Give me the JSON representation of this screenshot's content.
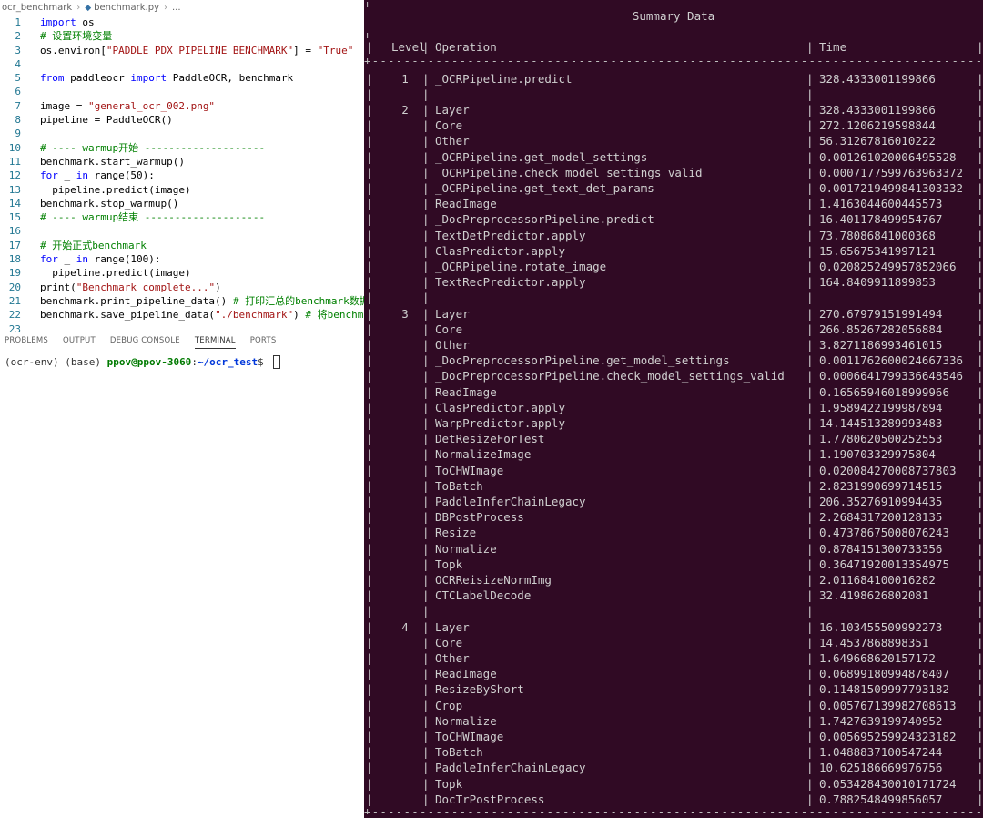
{
  "breadcrumb": {
    "folder": "ocr_benchmark",
    "file": "benchmark.py",
    "ellipsis": "..."
  },
  "code_lines": [
    {
      "n": "1",
      "t": [
        [
          "kw",
          "import"
        ],
        [
          "",
          "  os"
        ]
      ]
    },
    {
      "n": "2",
      "t": [
        [
          "cm",
          "# 设置环境变量"
        ]
      ]
    },
    {
      "n": "3",
      "t": [
        [
          "",
          "os.environ["
        ],
        [
          "str",
          "\"PADDLE_PDX_PIPELINE_BENCHMARK\""
        ],
        [
          "",
          "] = "
        ],
        [
          "str",
          "\"True\""
        ]
      ]
    },
    {
      "n": "4",
      "t": []
    },
    {
      "n": "5",
      "t": [
        [
          "kw",
          "from"
        ],
        [
          "",
          "  paddleocr  "
        ],
        [
          "kw",
          "import"
        ],
        [
          "",
          "  PaddleOCR, benchmark"
        ]
      ]
    },
    {
      "n": "6",
      "t": []
    },
    {
      "n": "7",
      "t": [
        [
          "",
          "image = "
        ],
        [
          "str",
          "\"general_ocr_002.png\""
        ]
      ]
    },
    {
      "n": "8",
      "t": [
        [
          "",
          "pipeline = PaddleOCR()"
        ]
      ]
    },
    {
      "n": "9",
      "t": []
    },
    {
      "n": "10",
      "t": [
        [
          "cm",
          "# ----  warmup开始 --------------------"
        ]
      ]
    },
    {
      "n": "11",
      "t": [
        [
          "",
          "benchmark.start_warmup()"
        ]
      ]
    },
    {
      "n": "12",
      "t": [
        [
          "kw",
          "for"
        ],
        [
          "",
          "  _  "
        ],
        [
          "kw",
          "in"
        ],
        [
          "",
          "  range(50):"
        ]
      ]
    },
    {
      "n": "13",
      "t": [
        [
          "",
          "    pipeline.predict(image)"
        ]
      ]
    },
    {
      "n": "14",
      "t": [
        [
          "",
          "benchmark.stop_warmup()"
        ]
      ]
    },
    {
      "n": "15",
      "t": [
        [
          "cm",
          "# ----  warmup结束 --------------------"
        ]
      ]
    },
    {
      "n": "16",
      "t": []
    },
    {
      "n": "17",
      "t": [
        [
          "cm",
          "# 开始正式benchmark"
        ]
      ]
    },
    {
      "n": "18",
      "t": [
        [
          "kw",
          "for"
        ],
        [
          "",
          "  _  "
        ],
        [
          "kw",
          "in"
        ],
        [
          "",
          "  range(100):"
        ]
      ]
    },
    {
      "n": "19",
      "t": [
        [
          "",
          "    pipeline.predict(image)"
        ]
      ]
    },
    {
      "n": "20",
      "t": [
        [
          "",
          "print("
        ],
        [
          "str",
          "\"Benchmark complete...\""
        ],
        [
          "",
          ")"
        ]
      ]
    },
    {
      "n": "21",
      "t": [
        [
          "",
          "benchmark.print_pipeline_data() "
        ],
        [
          "cm",
          "# 打印汇总的benchmark数据"
        ]
      ]
    },
    {
      "n": "22",
      "t": [
        [
          "",
          "benchmark.save_pipeline_data("
        ],
        [
          "str",
          "\"./benchmark\""
        ],
        [
          "",
          ") "
        ],
        [
          "cm",
          "# 将benchmark"
        ]
      ]
    },
    {
      "n": "23",
      "t": []
    }
  ],
  "panel_tabs": [
    "PROBLEMS",
    "OUTPUT",
    "DEBUG CONSOLE",
    "TERMINAL",
    "PORTS"
  ],
  "active_panel_tab": "TERMINAL",
  "terminal_prompt": {
    "env": "(ocr-env) (base) ",
    "user": "ppov@ppov-3060",
    "colon": ":",
    "path": "~/ocr_test",
    "dollar": "$ "
  },
  "summary": {
    "title": "Summary Data",
    "headers": {
      "level": "Level",
      "operation": "Operation",
      "time": "Time"
    },
    "groups": [
      {
        "level": "1",
        "rows": [
          [
            "_OCRPipeline.predict",
            "328.4333001199866"
          ]
        ]
      },
      {
        "level": "2",
        "rows": [
          [
            "Layer",
            "328.4333001199866"
          ],
          [
            "Core",
            "272.1206219598844"
          ],
          [
            "Other",
            "56.31267816010222"
          ],
          [
            "_OCRPipeline.get_model_settings",
            "0.001261020006495528"
          ],
          [
            "_OCRPipeline.check_model_settings_valid",
            "0.0007177599763963372"
          ],
          [
            "_OCRPipeline.get_text_det_params",
            "0.0017219499841303332"
          ],
          [
            "ReadImage",
            "1.4163044600445573"
          ],
          [
            "_DocPreprocessorPipeline.predict",
            "16.401178499954767"
          ],
          [
            "TextDetPredictor.apply",
            "73.78086841000368"
          ],
          [
            "ClasPredictor.apply",
            "15.65675341997121"
          ],
          [
            "_OCRPipeline.rotate_image",
            "0.020825249957852066"
          ],
          [
            "TextRecPredictor.apply",
            "164.8409911899853"
          ]
        ]
      },
      {
        "level": "3",
        "rows": [
          [
            "Layer",
            "270.67979151991494"
          ],
          [
            "Core",
            "266.85267282056884"
          ],
          [
            "Other",
            "3.8271186993461015"
          ],
          [
            "_DocPreprocessorPipeline.get_model_settings",
            "0.0011762600024667336"
          ],
          [
            "_DocPreprocessorPipeline.check_model_settings_valid",
            "0.0006641799336648546"
          ],
          [
            "ReadImage",
            "0.16565946018999966"
          ],
          [
            "ClasPredictor.apply",
            "1.9589422199987894"
          ],
          [
            "WarpPredictor.apply",
            "14.144513289993483"
          ],
          [
            "DetResizeForTest",
            "1.7780620500252553"
          ],
          [
            "NormalizeImage",
            "1.190703329975804"
          ],
          [
            "ToCHWImage",
            "0.020084270008737803"
          ],
          [
            "ToBatch",
            "2.8231990699714515"
          ],
          [
            "PaddleInferChainLegacy",
            "206.35276910994435"
          ],
          [
            "DBPostProcess",
            "2.2684317200128135"
          ],
          [
            "Resize",
            "0.47378675008076243"
          ],
          [
            "Normalize",
            "0.8784151300733356"
          ],
          [
            "Topk",
            "0.36471920013354975"
          ],
          [
            "OCRReisizeNormImg",
            "2.011684100016282"
          ],
          [
            "CTCLabelDecode",
            "32.4198626802081"
          ]
        ]
      },
      {
        "level": "4",
        "rows": [
          [
            "Layer",
            "16.103455509992273"
          ],
          [
            "Core",
            "14.4537868898351"
          ],
          [
            "Other",
            "1.649668620157172"
          ],
          [
            "ReadImage",
            "0.06899180994878407"
          ],
          [
            "ResizeByShort",
            "0.11481509997793182"
          ],
          [
            "Crop",
            "0.005767139982708613"
          ],
          [
            "Normalize",
            "1.7427639199740952"
          ],
          [
            "ToCHWImage",
            "0.005695259924323182"
          ],
          [
            "ToBatch",
            "1.0488837100547244"
          ],
          [
            "PaddleInferChainLegacy",
            "10.625186669976756"
          ],
          [
            "Topk",
            "0.053428430010171724"
          ],
          [
            "DocTrPostProcess",
            "0.7882548499856057"
          ]
        ]
      }
    ]
  },
  "colors": {
    "terminal_bg": "#300a24",
    "keyword": "#0000ff",
    "comment": "#008000",
    "string": "#a31515",
    "line_number": "#237893"
  }
}
